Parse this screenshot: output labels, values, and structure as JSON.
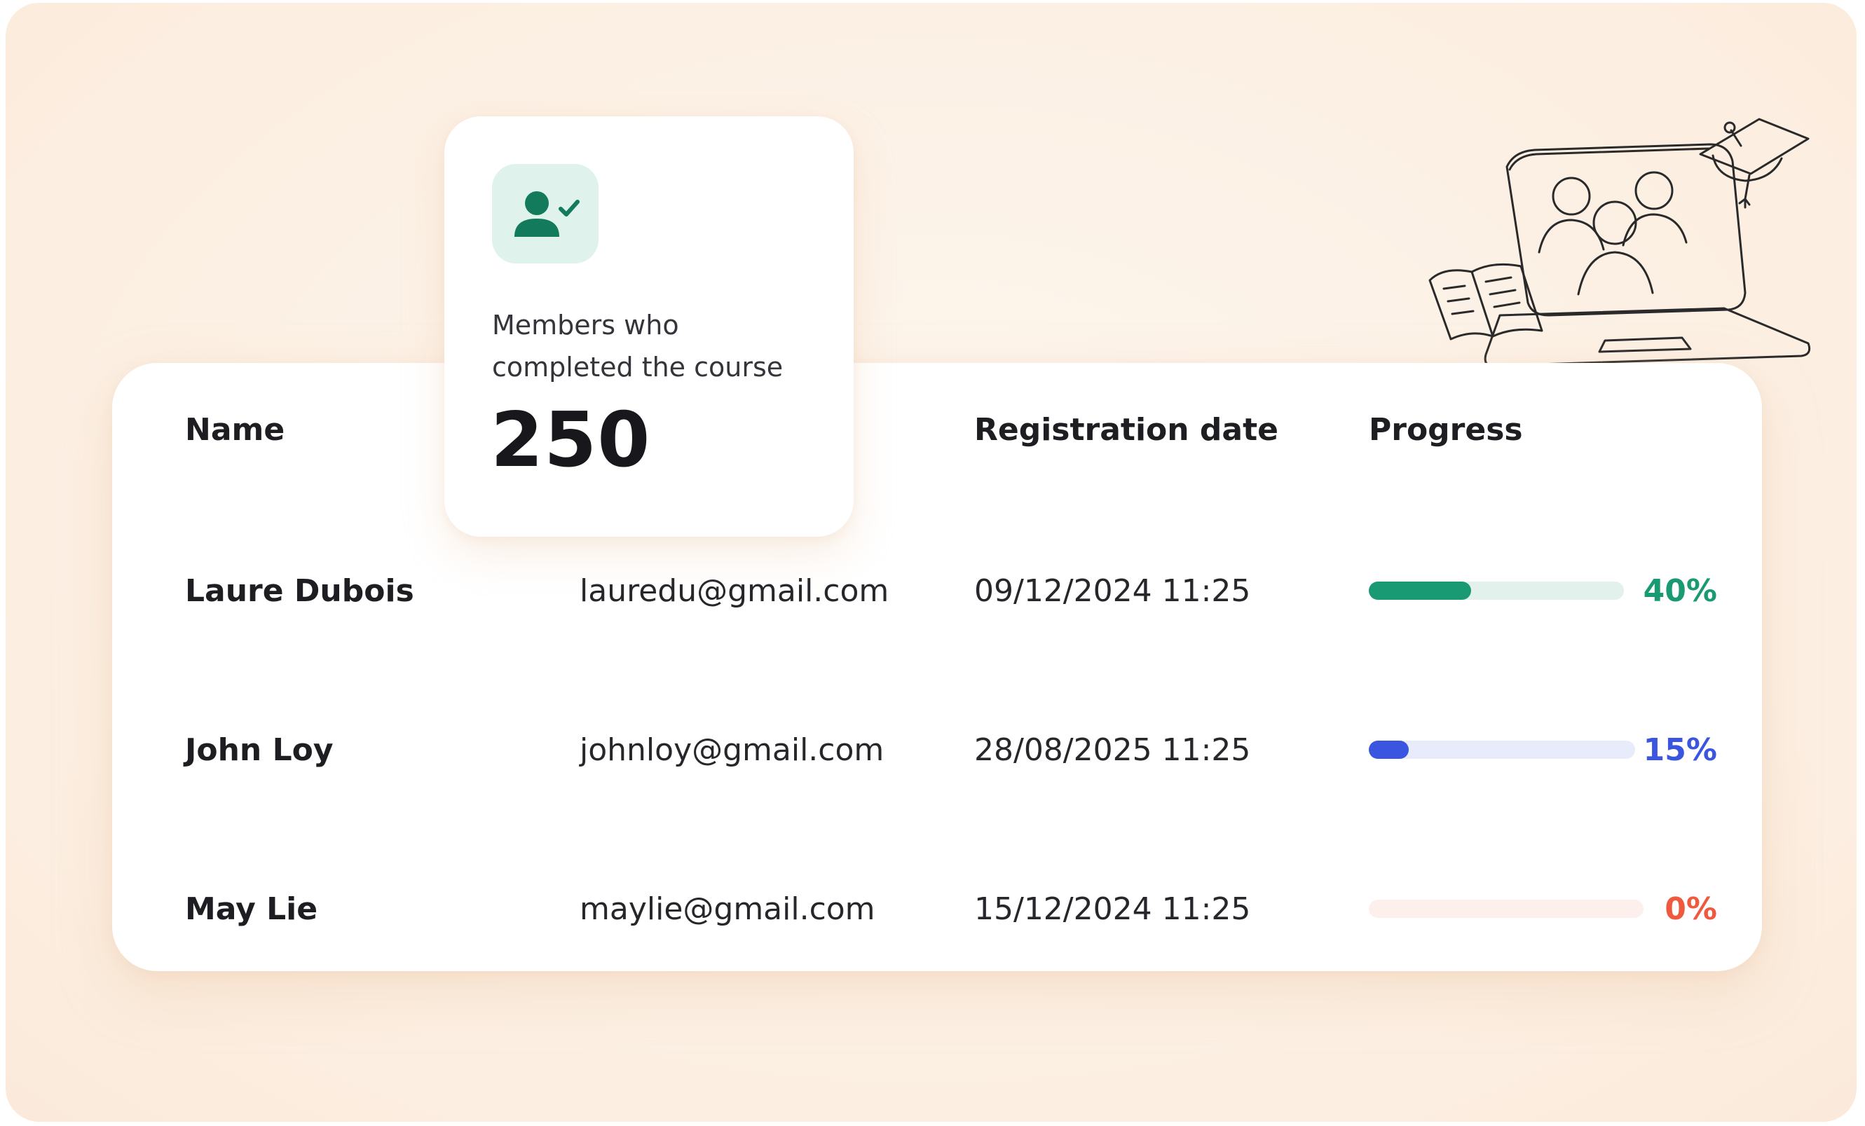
{
  "stat_card": {
    "label_line1": "Members who",
    "label_line2": "completed the course",
    "value": "250",
    "icon": "user-check-icon"
  },
  "table": {
    "headers": {
      "name": "Name",
      "registration_date": "Registration date",
      "progress": "Progress"
    },
    "rows": [
      {
        "name": "Laure Dubois",
        "email": "lauredu@gmail.com",
        "date": "09/12/2024 11:25",
        "progress_label": "40%",
        "progress": 0.4,
        "color": "#1a9a72",
        "track_color": "#e2f1ec"
      },
      {
        "name": "John Loy",
        "email": "johnloy@gmail.com",
        "date": "28/08/2025 11:25",
        "progress_label": "15%",
        "progress": 0.15,
        "color": "#3a55e0",
        "track_color": "#e8ebf9"
      },
      {
        "name": "May Lie",
        "email": "maylie@gmail.com",
        "date": "15/12/2024 11:25",
        "progress_label": "0%",
        "progress": 0.0,
        "color": "#ef5a3e",
        "track_color": "#fdf0ec"
      }
    ]
  },
  "illustration": {
    "icon": "online-classroom-illustration"
  }
}
